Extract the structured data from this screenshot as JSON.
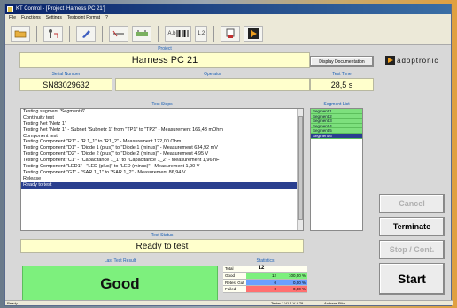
{
  "window": {
    "title": "KT Control - [Project 'Harness PC 21']"
  },
  "menu": [
    "File",
    "Functions",
    "Settings",
    "Testpoint Format",
    "?"
  ],
  "toolbar": {
    "buttons": [
      "open-folder-icon",
      "test-probe-icon",
      "edit-pen-icon",
      "wire-icon",
      "network-icon",
      "ab-barcode-icon",
      "barcode-icon",
      "one-two-icon",
      "export-icon",
      "play-icon"
    ],
    "ab_label": "A,b",
    "one_two_label": "1,2"
  },
  "project": {
    "label": "Project",
    "value": "Harness PC 21"
  },
  "display_doc_button": "Display Documentation",
  "logo": "adoptronic",
  "serial": {
    "label": "Serial Number",
    "value": "SN83029632"
  },
  "operator": {
    "label": "Operator",
    "value": ""
  },
  "test_time": {
    "label": "Test Time",
    "value": "28,5 s"
  },
  "test_steps": {
    "label": "Test Steps",
    "rows": [
      "Testing segment 'Segment 6'",
      "Continuity test",
      "Testing Net \"Netz 1\"",
      "Testing Net \"Netz 1\" - Subnet \"Subnetz 1\" from \"TP1\" to \"TP2\" - Measurement 166,43 mOhm",
      "Component test",
      "Testing Component \"R1\" - \"R 1_1\" to \"R1_2\" - Measurement 122,00 Ohm",
      "Testing Component \"D1\" - \"Diode 1 (plus)\" to \"Diode 1 (minus)\" - Measurement 634,92 mV",
      "Testing Component \"D2\" - \"Diode 2 (plus)\" to \"Diode 2 (minus)\" - Measurement 4,95 V",
      "Testing Component \"C1\" - \"Capacitance 1_1\" to \"Capacitance 1_2\" - Measurement 1,96 nF",
      "Testing Component \"LED1\" - \"LED (plus)\" to \"LED (minus)\" - Measurement 1,90 V",
      "Testing Component \"G1\" - \"SAR 1_1\" to \"SAR 1_2\" - Measurement 86,94 V",
      "Release",
      "Ready to test"
    ],
    "selected_index": 12
  },
  "segment_list": {
    "label": "Segment List",
    "items": [
      "Segment 1",
      "Segment 2",
      "Segment 3",
      "Segment 4",
      "Segment 5",
      "Segment 6"
    ],
    "selected_index": 5
  },
  "buttons": {
    "cancel": "Cancel",
    "terminate": "Terminate",
    "stop_cont": "Stop / Cont.",
    "start": "Start"
  },
  "test_status": {
    "label": "Test Status",
    "value": "Ready to test"
  },
  "last_result": {
    "label": "Last Test Result",
    "value": "Good"
  },
  "statistics": {
    "label": "Statistics",
    "rows": [
      {
        "name": "Total",
        "count": "12",
        "pct": ""
      },
      {
        "name": "Good",
        "count": "12",
        "pct": "100,00 %"
      },
      {
        "name": "Retest Gut",
        "count": "0",
        "pct": "0,00 %"
      },
      {
        "name": "Failed",
        "count": "0",
        "pct": "0,00 %"
      }
    ],
    "colors": {
      "good": "#7df07d",
      "retest": "#6aa0ff",
      "failed": "#ff7070"
    }
  },
  "statusbar": {
    "left": "Ready",
    "middle": "Tester 1 V1.1 V 4.79",
    "right": "Andreas Pilot"
  }
}
